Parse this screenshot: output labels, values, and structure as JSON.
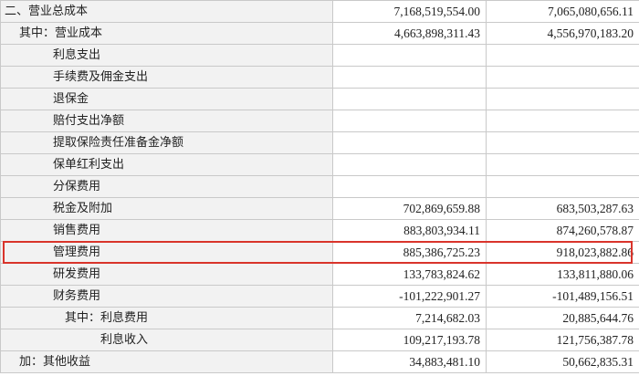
{
  "rows": [
    {
      "label": "二、营业总成本",
      "current": "7,168,519,554.00",
      "previous": "7,065,080,656.11"
    },
    {
      "label": "其中：营业成本",
      "current": "4,663,898,311.43",
      "previous": "4,556,970,183.20"
    },
    {
      "label": "利息支出",
      "current": "",
      "previous": ""
    },
    {
      "label": "手续费及佣金支出",
      "current": "",
      "previous": ""
    },
    {
      "label": "退保金",
      "current": "",
      "previous": ""
    },
    {
      "label": "赔付支出净额",
      "current": "",
      "previous": ""
    },
    {
      "label": "提取保险责任准备金净额",
      "current": "",
      "previous": ""
    },
    {
      "label": "保单红利支出",
      "current": "",
      "previous": ""
    },
    {
      "label": "分保费用",
      "current": "",
      "previous": ""
    },
    {
      "label": "税金及附加",
      "current": "702,869,659.88",
      "previous": "683,503,287.63"
    },
    {
      "label": "销售费用",
      "current": "883,803,934.11",
      "previous": "874,260,578.87"
    },
    {
      "label": "管理费用",
      "current": "885,386,725.23",
      "previous": "918,023,882.86"
    },
    {
      "label": "研发费用",
      "current": "133,783,824.62",
      "previous": "133,811,880.06"
    },
    {
      "label": "财务费用",
      "current": "-101,222,901.27",
      "previous": "-101,489,156.51"
    },
    {
      "label": "其中：利息费用",
      "current": "7,214,682.03",
      "previous": "20,885,644.76"
    },
    {
      "label": "利息收入",
      "current": "109,217,193.78",
      "previous": "121,756,387.78"
    },
    {
      "label": "加：其他收益",
      "current": "34,883,481.10",
      "previous": "50,662,835.31"
    }
  ],
  "highlight_color": "#d9342b"
}
